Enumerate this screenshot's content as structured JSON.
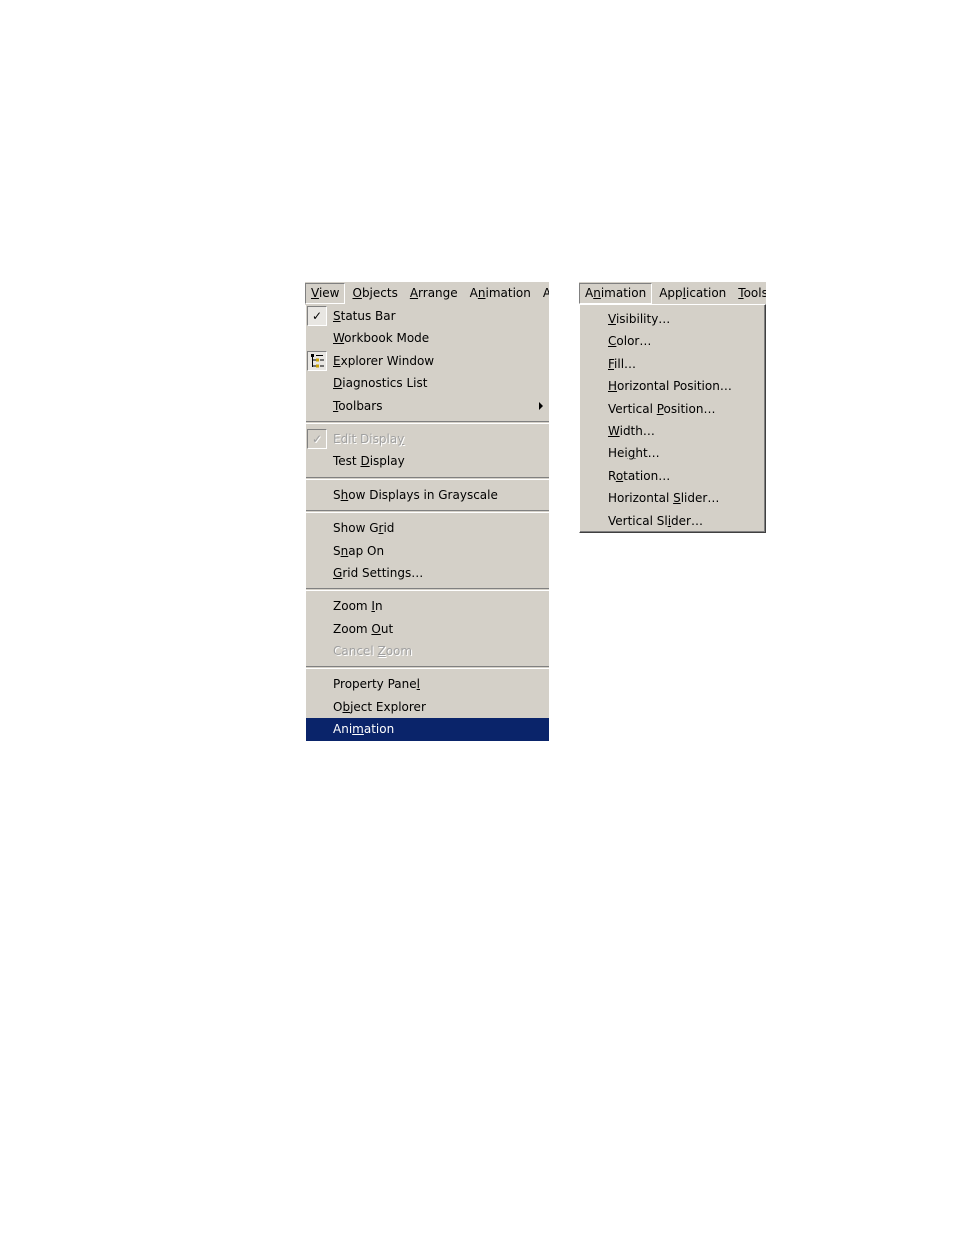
{
  "left_menubar": {
    "items": [
      {
        "pre": "",
        "acc": "V",
        "post": "iew",
        "active": true
      },
      {
        "pre": "",
        "acc": "O",
        "post": "bjects"
      },
      {
        "pre": "",
        "acc": "A",
        "post": "rrange"
      },
      {
        "pre": "A",
        "acc": "n",
        "post": "imation"
      },
      {
        "pre": "Ap",
        "acc": "",
        "post": ""
      }
    ]
  },
  "view_menu": {
    "status_bar": {
      "pre": "",
      "acc": "S",
      "post": "tatus Bar",
      "checked": true,
      "check_glyph": "✓"
    },
    "workbook_mode": {
      "pre": "",
      "acc": "W",
      "post": "orkbook Mode"
    },
    "explorer_window": {
      "pre": "",
      "acc": "E",
      "post": "xplorer Window",
      "icon": "tree-view-icon"
    },
    "diagnostics_list": {
      "pre": "",
      "acc": "D",
      "post": "iagnostics List"
    },
    "toolbars": {
      "pre": "",
      "acc": "T",
      "post": "oolbars",
      "submenu": true
    },
    "edit_display": {
      "pre": "Edit Displa",
      "acc": "y",
      "post": "",
      "checked": true,
      "disabled": true,
      "check_glyph": "✓"
    },
    "test_display": {
      "pre": "Test ",
      "acc": "D",
      "post": "isplay"
    },
    "show_grayscale": {
      "pre": "S",
      "acc": "h",
      "post": "ow Displays in Grayscale"
    },
    "show_grid": {
      "pre": "Show G",
      "acc": "r",
      "post": "id"
    },
    "snap_on": {
      "pre": "S",
      "acc": "n",
      "post": "ap On"
    },
    "grid_settings": {
      "pre": "",
      "acc": "G",
      "post": "rid Settings…"
    },
    "zoom_in": {
      "pre": "Zoom ",
      "acc": "I",
      "post": "n"
    },
    "zoom_out": {
      "pre": "Zoom ",
      "acc": "O",
      "post": "ut"
    },
    "cancel_zoom": {
      "pre": "Cancel ",
      "acc": "Z",
      "post": "oom",
      "disabled": true
    },
    "property_panel": {
      "pre": "Property Pane",
      "acc": "l",
      "post": ""
    },
    "object_explorer": {
      "pre": "O",
      "acc": "b",
      "post": "ject Explorer"
    },
    "animation": {
      "pre": "Ani",
      "acc": "m",
      "post": "ation",
      "highlighted": true
    }
  },
  "right_menubar": {
    "items": [
      {
        "pre": "A",
        "acc": "n",
        "post": "imation",
        "active": true
      },
      {
        "pre": "App",
        "acc": "l",
        "post": "ication"
      },
      {
        "pre": "",
        "acc": "T",
        "post": "ools"
      }
    ]
  },
  "animation_menu": {
    "items": [
      {
        "pre": "",
        "acc": "V",
        "post": "isibility…"
      },
      {
        "pre": "",
        "acc": "C",
        "post": "olor…"
      },
      {
        "pre": "",
        "acc": "F",
        "post": "ill…"
      },
      {
        "pre": "",
        "acc": "H",
        "post": "orizontal Position…"
      },
      {
        "pre": "Vertical ",
        "acc": "P",
        "post": "osition…"
      },
      {
        "pre": "",
        "acc": "W",
        "post": "idth…"
      },
      {
        "pre": "Hei",
        "acc": "g",
        "post": "ht…"
      },
      {
        "pre": "R",
        "acc": "o",
        "post": "tation…"
      },
      {
        "pre": "Horizontal ",
        "acc": "S",
        "post": "lider…"
      },
      {
        "pre": "Vertical Sl",
        "acc": "i",
        "post": "der…"
      }
    ]
  },
  "colors": {
    "menu_bg": "#d4d0c8",
    "highlight_bg": "#0a246a",
    "disabled_text": "#a0a0a0"
  }
}
